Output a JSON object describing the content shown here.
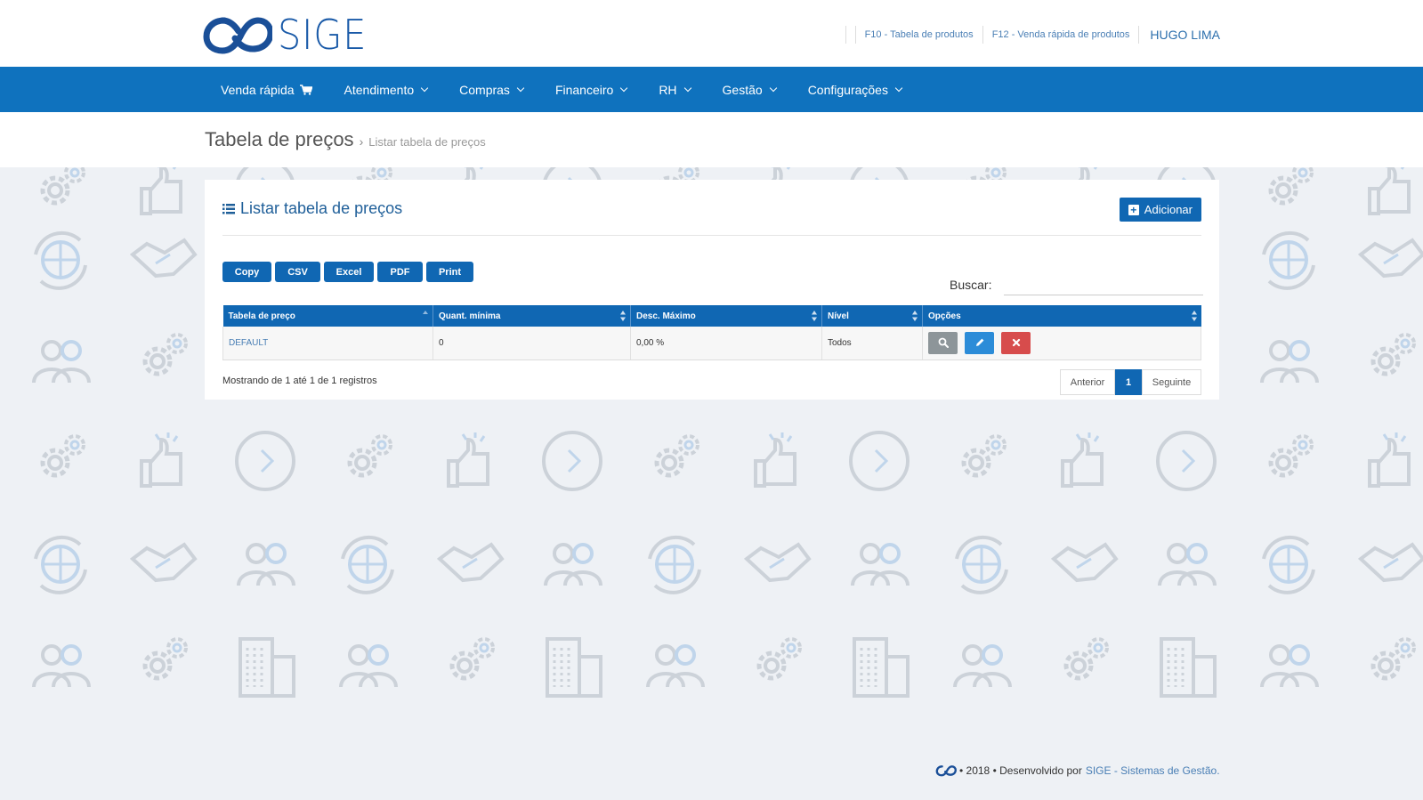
{
  "header": {
    "logo_text": "SIGE",
    "links": [
      {
        "label": "F10 - Tabela de produtos"
      },
      {
        "label": "F12 - Venda rápida de produtos"
      }
    ],
    "user_name": "HUGO LIMA"
  },
  "nav": {
    "items": [
      {
        "label": "Venda rápida"
      },
      {
        "label": "Atendimento"
      },
      {
        "label": "Compras"
      },
      {
        "label": "Financeiro"
      },
      {
        "label": "RH"
      },
      {
        "label": "Gestão"
      },
      {
        "label": "Configurações"
      }
    ]
  },
  "breadcrumb": {
    "title": "Tabela de preços",
    "separator": "›",
    "current": "Listar tabela de preços"
  },
  "panel": {
    "title": "Listar tabela de preços",
    "add_label": "Adicionar",
    "export_buttons": [
      "Copy",
      "CSV",
      "Excel",
      "PDF",
      "Print"
    ],
    "search_label": "Buscar:",
    "search_value": "",
    "table": {
      "columns": [
        "Tabela de preço",
        "Quant. mínima",
        "Desc. Máximo",
        "Nível",
        "Opções"
      ],
      "rows": [
        {
          "tabela": "DEFAULT",
          "quant_minima": "0",
          "desc_maximo": "0,00 %",
          "nivel": "Todos"
        }
      ]
    },
    "info": "Mostrando de 1 até 1 de 1 registros",
    "pager": {
      "prev": "Anterior",
      "current": "1",
      "next": "Seguinte"
    }
  },
  "footer": {
    "text": "• 2018 • Desenvolvido por",
    "link": "SIGE - Sistemas de Gestão."
  },
  "colors": {
    "brand": "#0f72be",
    "button": "#1067b3",
    "danger": "#d74c4c",
    "edit": "#2c8cd8",
    "view": "#8d9599"
  }
}
